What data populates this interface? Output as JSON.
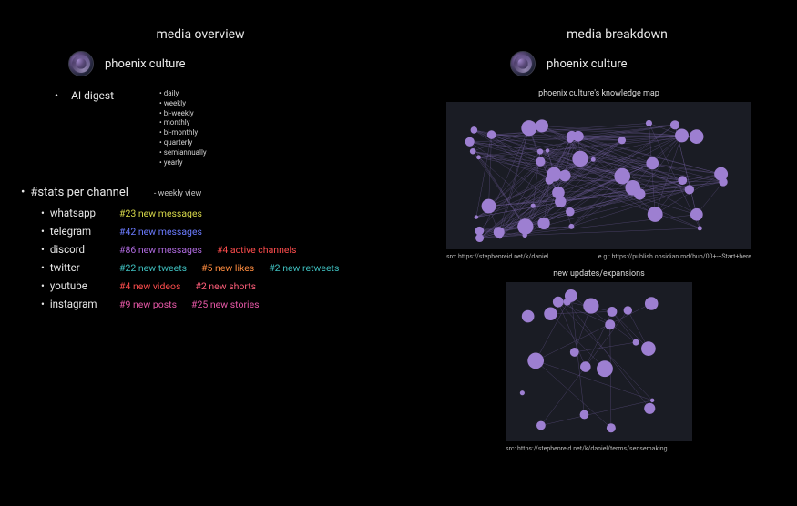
{
  "left": {
    "title": "media overview",
    "brand": "phoenix culture",
    "digest_label": "AI digest",
    "frequencies": [
      "daily",
      "weekly",
      "bi-weekly",
      "monthly",
      "bi-monthly",
      "quarterly",
      "semiannually",
      "yearly"
    ],
    "stats_header": "#stats per channel",
    "stats_sub": "- weekly view",
    "channels": [
      {
        "name": "whatsapp",
        "stats": [
          {
            "text": "#23 new messages",
            "cls": "c-yellow"
          }
        ]
      },
      {
        "name": "telegram",
        "stats": [
          {
            "text": "#42 new messages",
            "cls": "c-blue"
          }
        ]
      },
      {
        "name": "discord",
        "stats": [
          {
            "text": "#86 new messages",
            "cls": "c-purple"
          },
          {
            "text": "#4 active channels",
            "cls": "c-red"
          }
        ]
      },
      {
        "name": "twitter",
        "stats": [
          {
            "text": "#22 new tweets",
            "cls": "c-teal"
          },
          {
            "text": "#5 new likes",
            "cls": "c-orange"
          },
          {
            "text": "#2 new retweets",
            "cls": "c-teal"
          }
        ]
      },
      {
        "name": "youtube",
        "stats": [
          {
            "text": "#4 new videos",
            "cls": "c-red"
          },
          {
            "text": "#2 new shorts",
            "cls": "c-salmon"
          }
        ]
      },
      {
        "name": "instagram",
        "stats": [
          {
            "text": "#9 new posts",
            "cls": "c-pink"
          },
          {
            "text": "#25 new stories",
            "cls": "c-pink"
          }
        ]
      }
    ]
  },
  "right": {
    "title": "media breakdown",
    "brand": "phoenix culture",
    "graph1_title": "phoenix culture's knowledge map",
    "graph1_src": "src: https://stephenreid.net/k/daniel",
    "graph1_eg": "e.g.: https://publish.obsidian.md/hub/00+-+Start+here",
    "graph2_title": "new updates/expansions",
    "graph2_src": "src: https://stephenreid.net/k/daniel/terms/sensemaking"
  }
}
